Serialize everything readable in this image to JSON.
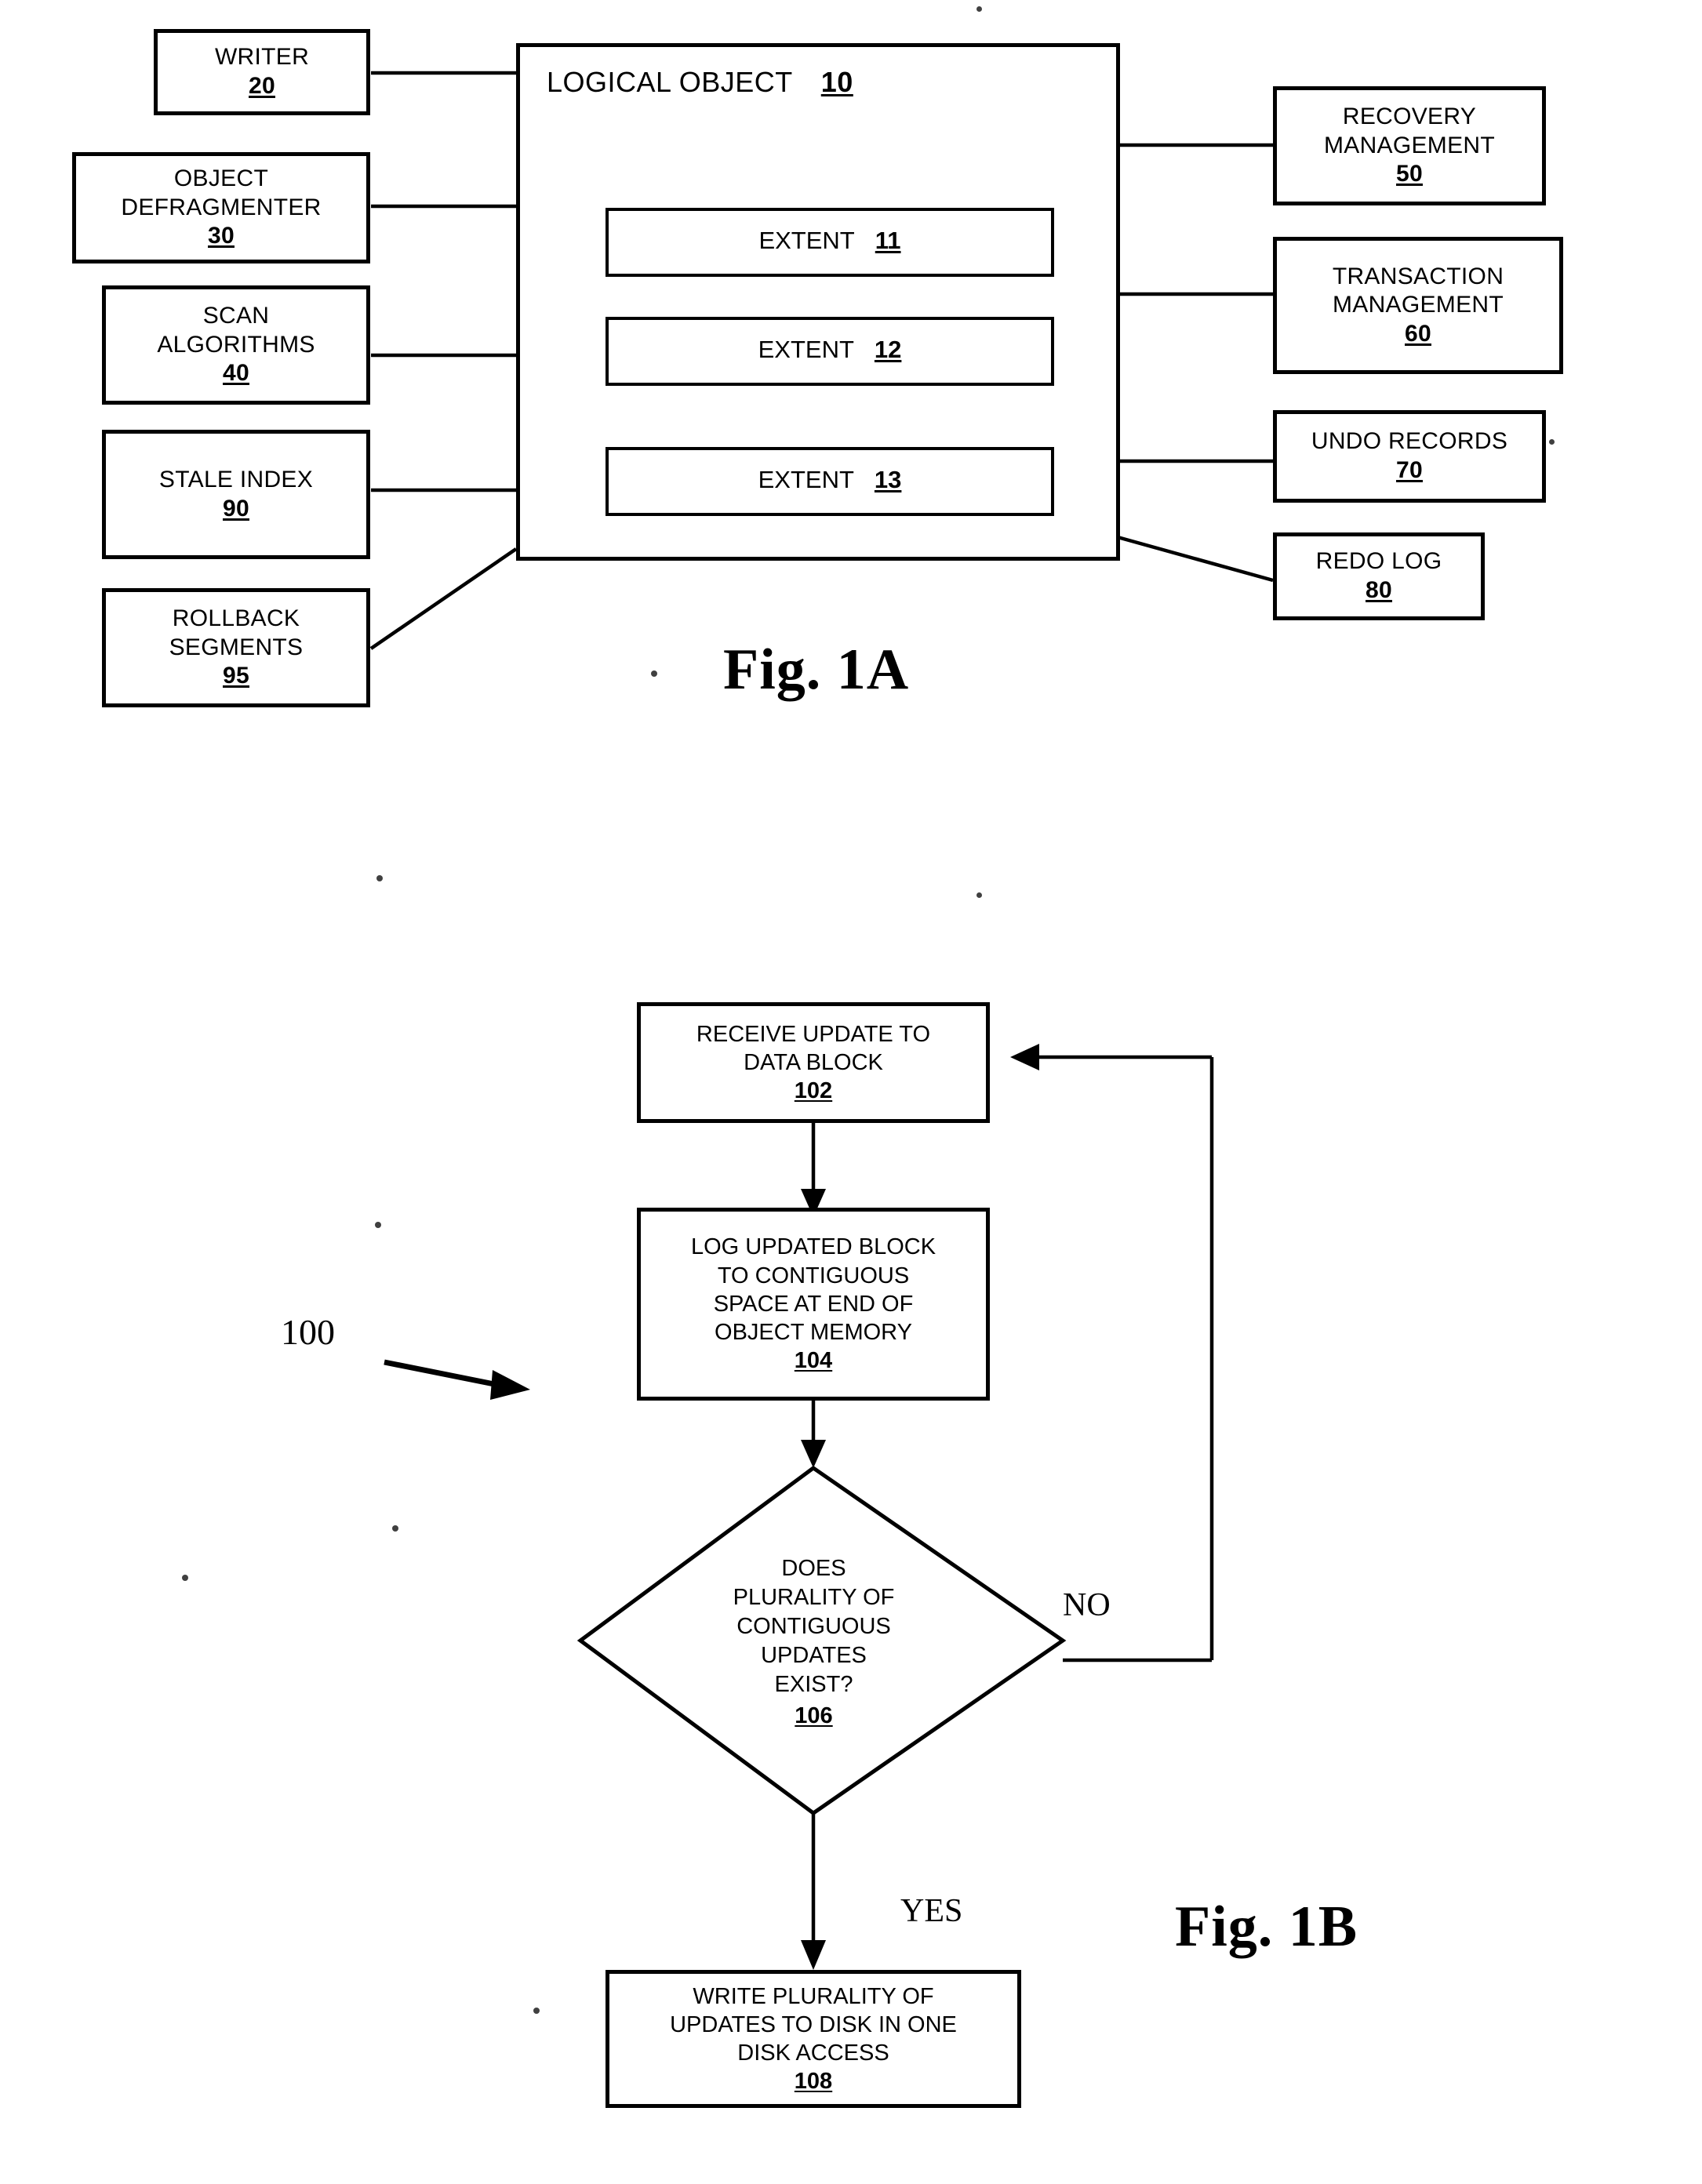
{
  "figure_a": {
    "caption": "Fig. 1A",
    "center": {
      "title": "LOGICAL OBJECT",
      "ref": "10",
      "extents": [
        {
          "label": "EXTENT",
          "ref": "11"
        },
        {
          "label": "EXTENT",
          "ref": "12"
        },
        {
          "label": "EXTENT",
          "ref": "13"
        }
      ]
    },
    "left_blocks": [
      {
        "text": "WRITER",
        "ref": "20"
      },
      {
        "text": "OBJECT\nDEFRAGMENTER",
        "ref": "30"
      },
      {
        "text": "SCAN\nALGORITHMS",
        "ref": "40"
      },
      {
        "text": "STALE INDEX",
        "ref": "90"
      },
      {
        "text": "ROLLBACK\nSEGMENTS",
        "ref": "95"
      }
    ],
    "right_blocks": [
      {
        "text": "RECOVERY\nMANAGEMENT",
        "ref": "50"
      },
      {
        "text": "TRANSACTION\nMANAGEMENT",
        "ref": "60"
      },
      {
        "text": "UNDO RECORDS",
        "ref": "70"
      },
      {
        "text": "REDO LOG",
        "ref": "80"
      }
    ]
  },
  "figure_b": {
    "caption": "Fig. 1B",
    "flow_ref": "100",
    "steps": [
      {
        "text": "RECEIVE UPDATE TO\nDATA BLOCK",
        "ref": "102"
      },
      {
        "text": "LOG UPDATED BLOCK\nTO CONTIGUOUS\nSPACE AT END OF\nOBJECT MEMORY",
        "ref": "104"
      },
      {
        "text": "WRITE PLURALITY OF\nUPDATES TO DISK IN ONE\nDISK ACCESS",
        "ref": "108"
      }
    ],
    "decision": {
      "text": "DOES\nPLURALITY OF\nCONTIGUOUS\nUPDATES\nEXIST?",
      "ref": "106"
    },
    "branch_labels": {
      "no": "NO",
      "yes": "YES"
    }
  },
  "colors": {
    "ink": "#000000",
    "paper": "#ffffff"
  }
}
